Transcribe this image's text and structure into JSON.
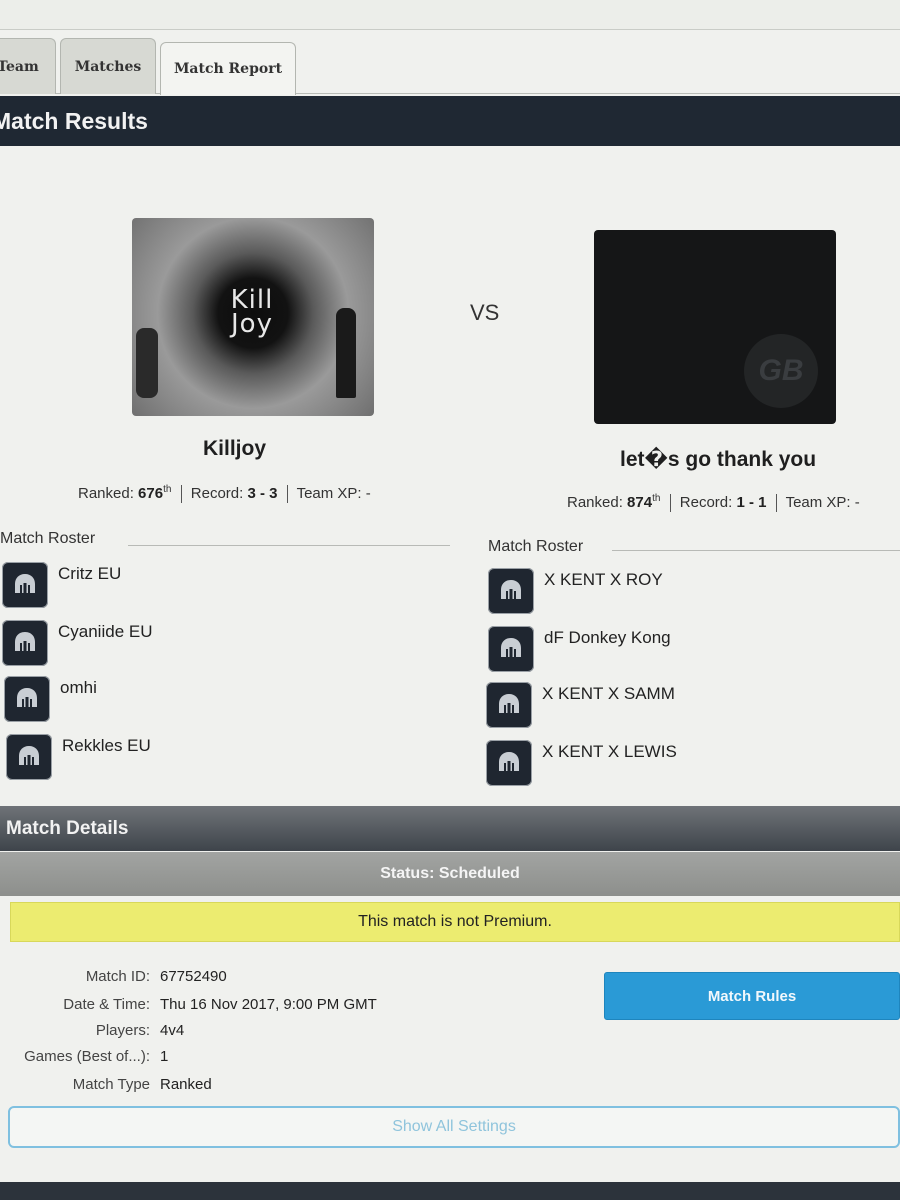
{
  "tabs": [
    {
      "label": "Team"
    },
    {
      "label": "Matches"
    },
    {
      "label": "Match Report"
    }
  ],
  "results": {
    "header": "Match Results",
    "vs": "VS",
    "team1": {
      "logo_text_1": "Kill",
      "logo_text_2": "Joy",
      "name": "Killjoy",
      "ranked_label": "Ranked:",
      "rank": "676",
      "rank_suffix": "th",
      "record_label": "Record:",
      "record": "3 - 3",
      "xp_label": "Team XP:",
      "xp": "-",
      "roster_title": "Match Roster",
      "roster": [
        "Critz EU",
        "Cyaniide EU",
        "omhi",
        "Rekkles EU"
      ]
    },
    "team2": {
      "logo_text": "GB",
      "name": "let�s go thank you",
      "ranked_label": "Ranked:",
      "rank": "874",
      "rank_suffix": "th",
      "record_label": "Record:",
      "record": "1 - 1",
      "xp_label": "Team XP:",
      "xp": "-",
      "roster_title": "Match Roster",
      "roster": [
        "X KENT X ROY",
        "dF Donkey Kong",
        "X KENT X SAMM",
        "X KENT X LEWIS"
      ]
    }
  },
  "details": {
    "header": "Match Details",
    "status": "Status: Scheduled",
    "premium_notice": "This match is not Premium.",
    "rows": [
      {
        "label": "Match ID:",
        "value": "67752490"
      },
      {
        "label": "Date & Time:",
        "value": "Thu 16 Nov 2017, 9:00 PM GMT"
      },
      {
        "label": "Players:",
        "value": "4v4"
      },
      {
        "label": "Games (Best of...):",
        "value": "1"
      },
      {
        "label": "Match Type",
        "value": "Ranked"
      }
    ],
    "rules_button": "Match Rules",
    "show_all_button": "Show All Settings"
  },
  "colors": {
    "header_bg": "#1f2833",
    "button_blue": "#2a9ad6",
    "premium_yellow": "#ecec70"
  },
  "icons": {
    "avatar": "spartan-helmet-icon"
  }
}
